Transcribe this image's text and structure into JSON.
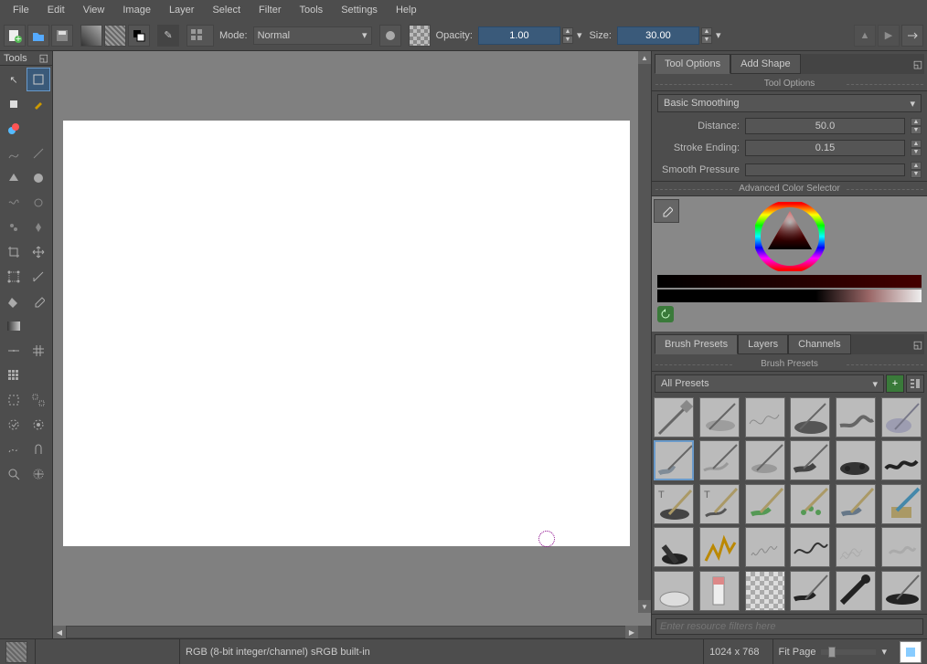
{
  "menu": {
    "items": [
      "File",
      "Edit",
      "View",
      "Image",
      "Layer",
      "Select",
      "Filter",
      "Tools",
      "Settings",
      "Help"
    ]
  },
  "toolbar": {
    "mode_label": "Mode:",
    "mode_value": "Normal",
    "opacity_label": "Opacity:",
    "opacity_value": "1.00",
    "size_label": "Size:",
    "size_value": "30.00"
  },
  "tools_panel": {
    "title": "Tools"
  },
  "right": {
    "tabs": {
      "tool_options": "Tool Options",
      "add_shape": "Add Shape"
    },
    "tool_options_title": "Tool Options",
    "smoothing_drop": "Basic Smoothing",
    "distance_label": "Distance:",
    "distance_value": "50.0",
    "stroke_ending_label": "Stroke Ending:",
    "stroke_ending_value": "0.15",
    "smooth_pressure_label": "Smooth Pressure",
    "color_title": "Advanced Color Selector",
    "brush_tabs": {
      "presets": "Brush Presets",
      "layers": "Layers",
      "channels": "Channels"
    },
    "brush_presets_title": "Brush Presets",
    "all_presets": "All Presets",
    "filter_placeholder": "Enter resource filters here"
  },
  "status": {
    "color_info": "RGB (8-bit integer/channel)  sRGB built-in",
    "dims": "1024 x 768",
    "fit": "Fit Page"
  }
}
